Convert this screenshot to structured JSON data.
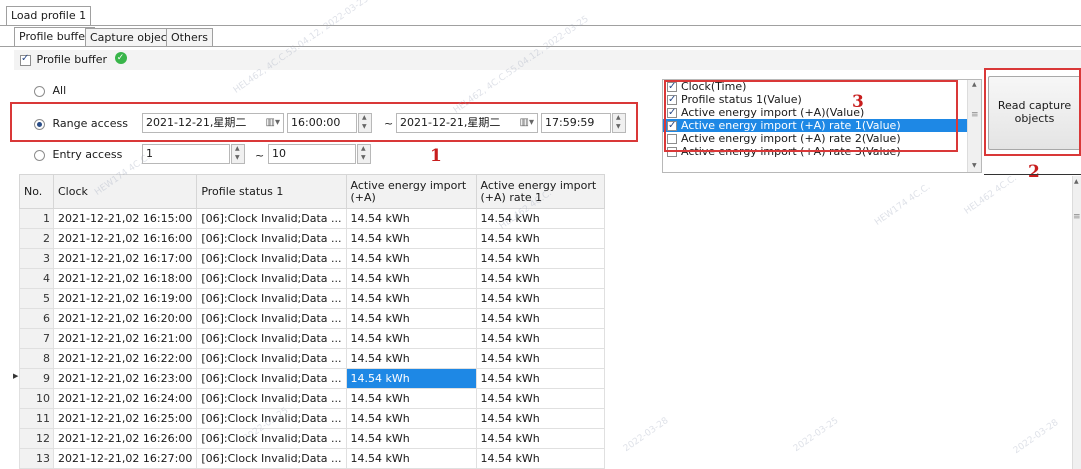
{
  "window_tab": "Load profile 1",
  "subtabs": [
    "Profile buffer",
    "Capture object",
    "Others"
  ],
  "profile_buffer_label": "Profile buffer",
  "access": {
    "all_label": "All",
    "range_label": "Range access",
    "entry_label": "Entry access",
    "range_start_date": "2021-12-21,星期二",
    "range_start_time": "16:00:00",
    "range_sep": "~",
    "range_end_date": "2021-12-21,星期二",
    "range_end_time": "17:59:59",
    "entry_start": "1",
    "entry_sep": "~",
    "entry_end": "10"
  },
  "capture_list": [
    {
      "label": "Clock(Time)",
      "checked": true,
      "selected": false
    },
    {
      "label": "Profile status 1(Value)",
      "checked": true,
      "selected": false
    },
    {
      "label": "Active energy import (+A)(Value)",
      "checked": true,
      "selected": false
    },
    {
      "label": "Active energy import (+A) rate 1(Value)",
      "checked": true,
      "selected": true
    },
    {
      "label": "Active energy import (+A) rate 2(Value)",
      "checked": false,
      "selected": false
    },
    {
      "label": "Active energy import (+A) rate 3(Value)",
      "checked": false,
      "selected": false
    }
  ],
  "read_button": {
    "line1": "Read capture",
    "line2": "objects"
  },
  "annotations": {
    "n1": "1",
    "n2": "2",
    "n3": "3"
  },
  "table": {
    "headers": [
      "No.",
      "Clock",
      "Profile status 1",
      "Active energy import (+A)",
      "Active energy import (+A) rate 1"
    ],
    "rows": [
      [
        "1",
        "2021-12-21,02 16:15:00",
        "[06]:Clock Invalid;Data ...",
        "14.54 kWh",
        "14.54 kWh"
      ],
      [
        "2",
        "2021-12-21,02 16:16:00",
        "[06]:Clock Invalid;Data ...",
        "14.54 kWh",
        "14.54 kWh"
      ],
      [
        "3",
        "2021-12-21,02 16:17:00",
        "[06]:Clock Invalid;Data ...",
        "14.54 kWh",
        "14.54 kWh"
      ],
      [
        "4",
        "2021-12-21,02 16:18:00",
        "[06]:Clock Invalid;Data ...",
        "14.54 kWh",
        "14.54 kWh"
      ],
      [
        "5",
        "2021-12-21,02 16:19:00",
        "[06]:Clock Invalid;Data ...",
        "14.54 kWh",
        "14.54 kWh"
      ],
      [
        "6",
        "2021-12-21,02 16:20:00",
        "[06]:Clock Invalid;Data ...",
        "14.54 kWh",
        "14.54 kWh"
      ],
      [
        "7",
        "2021-12-21,02 16:21:00",
        "[06]:Clock Invalid;Data ...",
        "14.54 kWh",
        "14.54 kWh"
      ],
      [
        "8",
        "2021-12-21,02 16:22:00",
        "[06]:Clock Invalid;Data ...",
        "14.54 kWh",
        "14.54 kWh"
      ],
      [
        "9",
        "2021-12-21,02 16:23:00",
        "[06]:Clock Invalid;Data ...",
        "14.54 kWh",
        "14.54 kWh"
      ],
      [
        "10",
        "2021-12-21,02 16:24:00",
        "[06]:Clock Invalid;Data ...",
        "14.54 kWh",
        "14.54 kWh"
      ],
      [
        "11",
        "2021-12-21,02 16:25:00",
        "[06]:Clock Invalid;Data ...",
        "14.54 kWh",
        "14.54 kWh"
      ],
      [
        "12",
        "2021-12-21,02 16:26:00",
        "[06]:Clock Invalid;Data ...",
        "14.54 kWh",
        "14.54 kWh"
      ],
      [
        "13",
        "2021-12-21,02 16:27:00",
        "[06]:Clock Invalid;Data ...",
        "14.54 kWh",
        "14.54 kWh"
      ]
    ]
  },
  "watermarks": [
    "HEW174 4C.C.",
    "HEL462 4C.C.",
    "2022-03-25",
    "2022-03-28",
    "HEL462, 4C.C.55.04.12, 2022-03-25"
  ]
}
